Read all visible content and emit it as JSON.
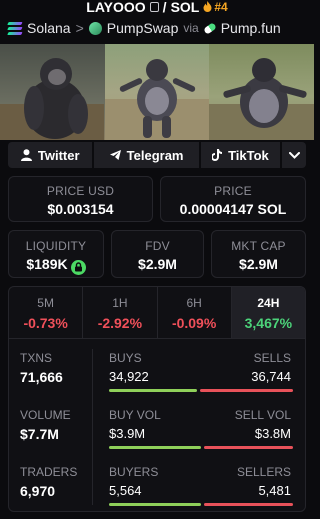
{
  "header": {
    "pair_base": "LAYOOO",
    "pair_sep": "/",
    "pair_quote": "SOL",
    "rank": "#4",
    "chain": "Solana",
    "chevron": ">",
    "dex": "PumpSwap",
    "via": "via",
    "launchpad": "Pump.fun"
  },
  "social": {
    "twitter": "Twitter",
    "telegram": "Telegram",
    "tiktok": "TikTok"
  },
  "price": {
    "usd_label": "PRICE USD",
    "usd_value": "$0.003154",
    "native_label": "PRICE",
    "native_value": "0.00004147 SOL"
  },
  "metrics": {
    "liquidity_label": "LIQUIDITY",
    "liquidity_value": "$189K",
    "fdv_label": "FDV",
    "fdv_value": "$2.9M",
    "mcap_label": "MKT CAP",
    "mcap_value": "$2.9M"
  },
  "timeframes": [
    {
      "label": "5M",
      "change": "-0.73%",
      "direction": "down"
    },
    {
      "label": "1H",
      "change": "-2.92%",
      "direction": "down"
    },
    {
      "label": "6H",
      "change": "-0.09%",
      "direction": "down"
    },
    {
      "label": "24H",
      "change": "3,467%",
      "direction": "up",
      "selected": true
    }
  ],
  "stats": {
    "txns_label": "TXNS",
    "txns_value": "71,666",
    "volume_label": "VOLUME",
    "volume_value": "$7.7M",
    "traders_label": "TRADERS",
    "traders_value": "6,970",
    "buys_label": "BUYS",
    "buys_value": "34,922",
    "sells_label": "SELLS",
    "sells_value": "36,744",
    "buy_vol_label": "BUY VOL",
    "buy_vol_value": "$3.9M",
    "sell_vol_label": "SELL VOL",
    "sell_vol_value": "$3.8M",
    "buyers_label": "BUYERS",
    "buyers_value": "5,564",
    "sellers_label": "SELLERS",
    "sellers_value": "5,481",
    "buy_share": {
      "txns": 0.487,
      "volume": 0.506,
      "traders": 0.504
    }
  },
  "colors": {
    "positive": "#4cd37a",
    "negative": "#f0505a",
    "buy_bar": "#8fd05a",
    "sell_bar": "#e8525a",
    "rank": "#f5a623"
  },
  "icons": [
    "copy-icon",
    "flame-icon",
    "solana-icon",
    "pumpswap-icon",
    "pill-icon",
    "user-icon",
    "telegram-icon",
    "tiktok-icon",
    "chevron-down-icon",
    "lock-icon"
  ]
}
